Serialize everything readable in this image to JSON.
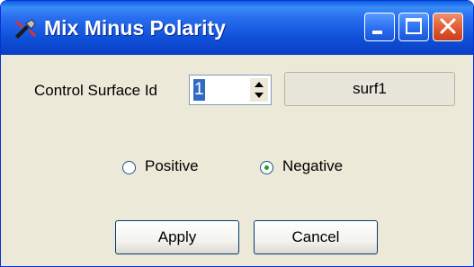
{
  "window": {
    "title": "Mix Minus Polarity",
    "app_icon": "microphone-icon",
    "controls": [
      "minimize-icon",
      "maximize-icon",
      "close-icon"
    ]
  },
  "form": {
    "control_surface_label": "Control Surface Id",
    "control_surface_value": "1",
    "surface_button_label": "surf1",
    "polarity": {
      "options": [
        "Positive",
        "Negative"
      ],
      "selected": "Negative"
    },
    "apply_label": "Apply",
    "cancel_label": "Cancel"
  },
  "colors": {
    "titlebar": "#0a5fe0",
    "client_background": "#ece9d8",
    "selection": "#316ac5",
    "radio_dot": "#21a121"
  }
}
